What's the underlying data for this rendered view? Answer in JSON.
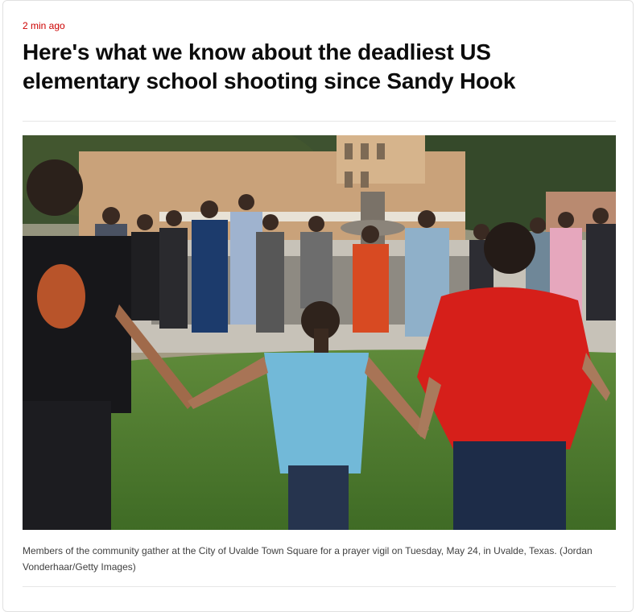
{
  "article": {
    "timestamp": "2 min ago",
    "headline": "Here's what we know about the deadliest US elementary school shooting since Sandy Hook",
    "caption": "Members of the community gather at the City of Uvalde Town Square for a prayer vigil on Tuesday, May 24, in Uvalde, Texas. (Jordan Vonderhaar/Getty Images)"
  },
  "colors": {
    "timestamp": "#cc0000",
    "headline": "#0c0c0c",
    "caption": "#404040",
    "divider": "#e6e6e6"
  }
}
